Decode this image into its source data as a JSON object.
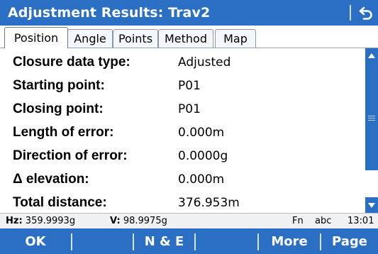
{
  "window": {
    "title": "Adjustment Results: Trav2"
  },
  "tabs": [
    {
      "label": "Position",
      "active": true
    },
    {
      "label": "Angle",
      "active": false
    },
    {
      "label": "Points",
      "active": false
    },
    {
      "label": "Method",
      "active": false
    },
    {
      "label": "Map",
      "active": false
    }
  ],
  "results": [
    {
      "label": "Closure data type:",
      "value": "Adjusted"
    },
    {
      "label": "Starting point:",
      "value": "P01"
    },
    {
      "label": "Closing point:",
      "value": "P01"
    },
    {
      "label": "Length of error:",
      "value": "0.000m"
    },
    {
      "label": "Direction of error:",
      "value": "0.0000g"
    },
    {
      "label": "Δ elevation:",
      "value": "0.000m"
    },
    {
      "label": "Total distance:",
      "value": "376.953m"
    }
  ],
  "status": {
    "hz_label": "Hz:",
    "hz_value": "359.9993g",
    "v_label": "V:",
    "v_value": "98.9975g",
    "fn": "Fn",
    "input_mode": "abc",
    "time": "13:01"
  },
  "softkeys": {
    "ok": "OK",
    "ne": "N & E",
    "more": "More",
    "page": "Page"
  },
  "icons": {
    "back": "back-arrow-icon",
    "scroll_up": "arrow-up-icon",
    "scroll_down": "arrow-down-icon"
  },
  "colors": {
    "accent": "#2a6fc3",
    "status_bg": "#f0f1f3"
  }
}
